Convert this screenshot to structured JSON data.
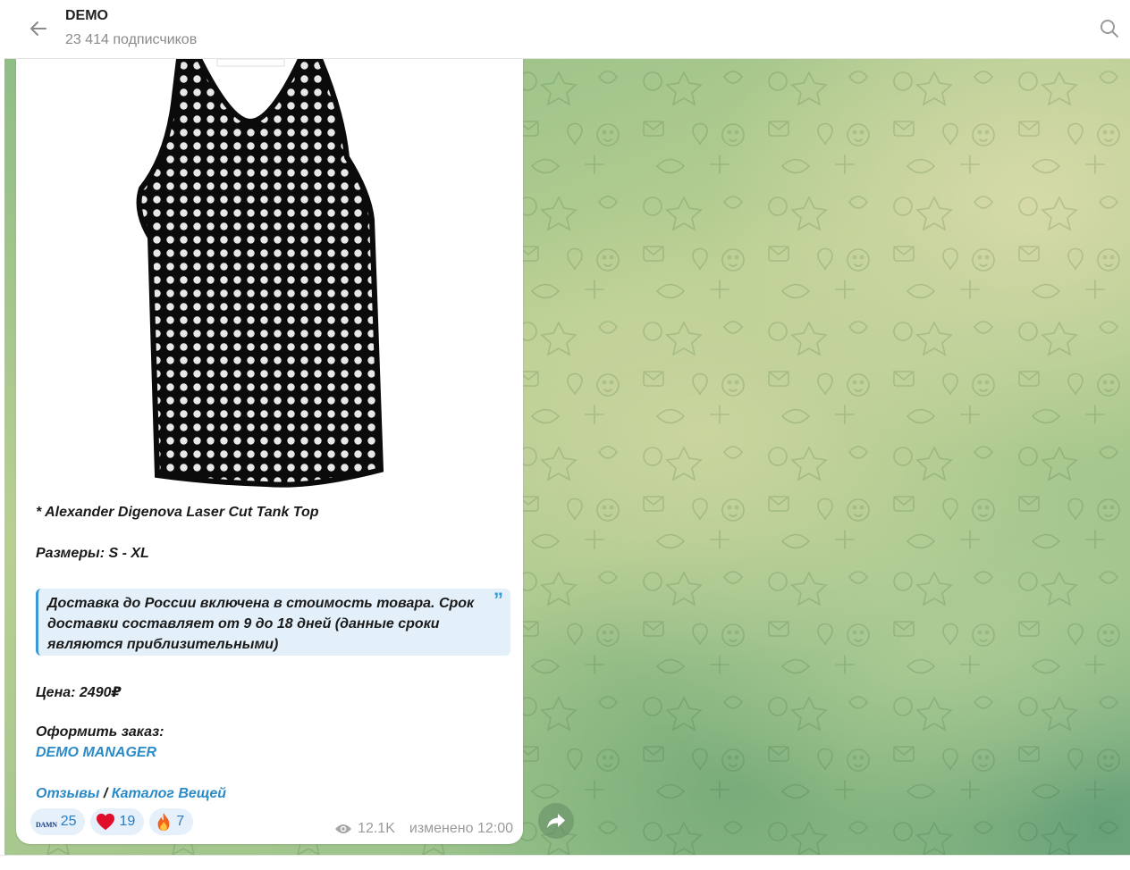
{
  "header": {
    "title": "DEMO",
    "subscribers": "23 414 подписчиков",
    "back_icon": "arrow-left-icon",
    "search_icon": "search-icon"
  },
  "post": {
    "product_line": "* Alexander Digenova Laser Cut Tank Top",
    "sizes": "Размеры: S - XL",
    "quote": "Доставка до России включена в стоимость товара. Срок доставки составляет от 9 до 18 дней (данные сроки являются приблизительными)",
    "price": "Цена: 2490₽",
    "order_label": "Оформить заказ:",
    "manager_link": "DEMO MANAGER",
    "reviews_link": "Отзывы",
    "separator": " / ",
    "catalog_link": "Каталог Вещей"
  },
  "reactions": [
    {
      "icon": "damn-sticker",
      "sticker_text": "DAMN",
      "count": "25"
    },
    {
      "icon": "heart-icon",
      "count": "19"
    },
    {
      "icon": "fire-icon",
      "count": "7"
    }
  ],
  "meta": {
    "views": "12.1K",
    "edited": "изменено 12:00"
  },
  "colors": {
    "link": "#2a8bc8",
    "quote_bg": "#e4f0f9",
    "quote_border": "#3a9ad9",
    "reaction_bg": "#e5f0fa"
  }
}
